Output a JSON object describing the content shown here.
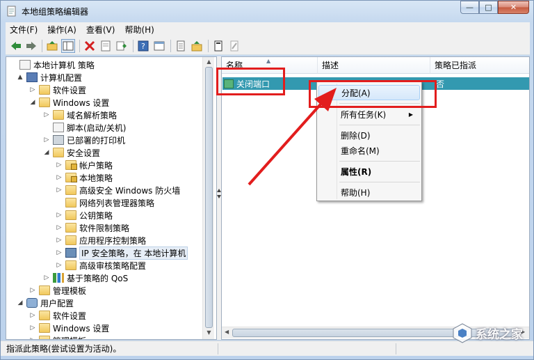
{
  "window": {
    "title": "本地组策略编辑器",
    "controls": {
      "minimize": "—",
      "maximize": "□",
      "close": "✕"
    }
  },
  "menubar": [
    "文件(F)",
    "操作(A)",
    "查看(V)",
    "帮助(H)"
  ],
  "toolbar": [
    "back-icon",
    "forward-icon",
    "up-folder-icon",
    "show-hide-tree-icon",
    "delete-icon",
    "properties-icon",
    "export-list-icon",
    "help-icon",
    "panel-icon",
    "document-icon",
    "import-icon",
    "script-icon",
    "script-disabled-icon"
  ],
  "tree": [
    {
      "label": "本地计算机 策略",
      "level": 0,
      "icon": "document-icon",
      "toggle": ""
    },
    {
      "label": "计算机配置",
      "level": 1,
      "icon": "computer-icon",
      "toggle": "▲"
    },
    {
      "label": "软件设置",
      "level": 2,
      "icon": "folder-icon",
      "toggle": "▷"
    },
    {
      "label": "Windows 设置",
      "level": 2,
      "icon": "folder-icon",
      "toggle": "◢"
    },
    {
      "label": "域名解析策略",
      "level": 3,
      "icon": "folder-icon",
      "toggle": "▷"
    },
    {
      "label": "脚本(启动/关机)",
      "level": 3,
      "icon": "script-icon",
      "toggle": ""
    },
    {
      "label": "已部署的打印机",
      "level": 3,
      "icon": "printer-icon",
      "toggle": "▷"
    },
    {
      "label": "安全设置",
      "level": 3,
      "icon": "security-folder-icon",
      "toggle": "◢"
    },
    {
      "label": "帐户策略",
      "level": 4,
      "icon": "locked-folder-icon",
      "toggle": "▷"
    },
    {
      "label": "本地策略",
      "level": 4,
      "icon": "locked-folder-icon",
      "toggle": "▷"
    },
    {
      "label": "高级安全 Windows 防火墙",
      "level": 4,
      "icon": "folder-icon",
      "toggle": "▷"
    },
    {
      "label": "网络列表管理器策略",
      "level": 4,
      "icon": "folder-icon",
      "toggle": ""
    },
    {
      "label": "公钥策略",
      "level": 4,
      "icon": "folder-icon",
      "toggle": "▷"
    },
    {
      "label": "软件限制策略",
      "level": 4,
      "icon": "folder-icon",
      "toggle": "▷"
    },
    {
      "label": "应用程序控制策略",
      "level": 4,
      "icon": "folder-icon",
      "toggle": "▷"
    },
    {
      "label": "IP 安全策略，在 本地计算机",
      "level": 4,
      "icon": "ip-security-icon",
      "toggle": "▷",
      "highlighted": true
    },
    {
      "label": "高级审核策略配置",
      "level": 4,
      "icon": "folder-icon",
      "toggle": "▷"
    },
    {
      "label": "基于策略的 QoS",
      "level": 3,
      "icon": "chart-bars-icon",
      "toggle": "▷"
    },
    {
      "label": "管理模板",
      "level": 2,
      "icon": "folder-icon",
      "toggle": "▷"
    },
    {
      "label": "用户配置",
      "level": 1,
      "icon": "user-icon",
      "toggle": "◢"
    },
    {
      "label": "软件设置",
      "level": 2,
      "icon": "folder-icon",
      "toggle": "▷"
    },
    {
      "label": "Windows 设置",
      "level": 2,
      "icon": "folder-icon",
      "toggle": "▷"
    },
    {
      "label": "管理模板",
      "level": 2,
      "icon": "folder-icon",
      "toggle": "▷"
    }
  ],
  "list": {
    "columns": [
      "名称",
      "描述",
      "策略已指派"
    ],
    "rows": [
      {
        "name": "关闭端口",
        "description": "",
        "assigned": "否"
      }
    ]
  },
  "context_menu": {
    "items": [
      {
        "label": "分配(A)",
        "active": true
      },
      {
        "label": "所有任务(K)",
        "submenu": "▶"
      },
      {
        "label": "删除(D)"
      },
      {
        "label": "重命名(M)"
      },
      {
        "label": "属性(R)",
        "bold": true
      },
      {
        "label": "帮助(H)"
      }
    ]
  },
  "statusbar": {
    "text": "指派此策略(尝试设置为活动)。"
  },
  "watermark": {
    "text": "系统之家"
  },
  "colors": {
    "selection": "#3399b0",
    "annotation": "#e21d1d",
    "menu_highlight": "#d6e8fb"
  }
}
